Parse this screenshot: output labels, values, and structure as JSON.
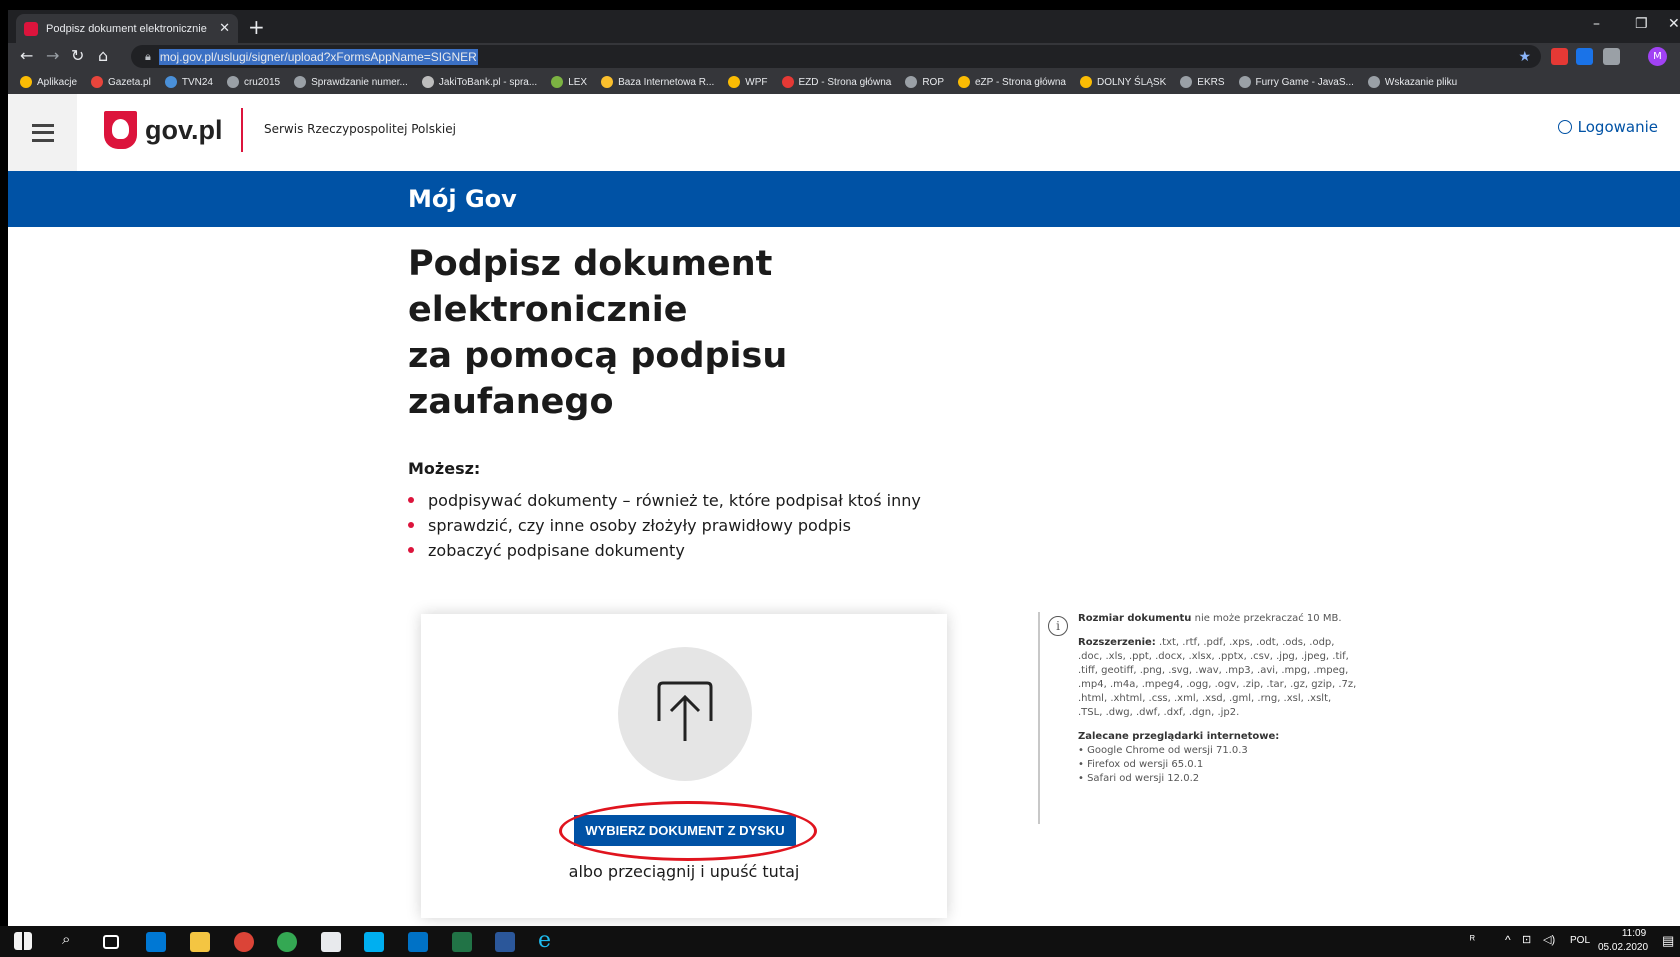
{
  "browser": {
    "tab_title": "Podpisz dokument elektronicznie",
    "tab_close": "✕",
    "new_tab": "+",
    "url": "moj.gov.pl/uslugi/signer/upload?xFormsAppName=SIGNER",
    "profile_initial": "M",
    "window_controls": [
      "–",
      "❐",
      "✕"
    ],
    "bookmarks": [
      {
        "label": "Aplikacje",
        "icon": "apps-grid-icon",
        "color": "#fbbc04"
      },
      {
        "label": "Gazeta.pl",
        "icon": "gazeta-icon",
        "color": "#e8453c"
      },
      {
        "label": "TVN24",
        "icon": "tvn24-icon",
        "color": "#4a90d9"
      },
      {
        "label": "cru2015",
        "icon": "globe-icon",
        "color": "#9aa0a6"
      },
      {
        "label": "Sprawdzanie numer...",
        "icon": "globe-icon",
        "color": "#9aa0a6"
      },
      {
        "label": "JakiToBank.pl - spra...",
        "icon": "jakitobank-icon",
        "color": "#bdbdbd"
      },
      {
        "label": "LEX",
        "icon": "lex-icon",
        "color": "#7cb342"
      },
      {
        "label": "Baza Internetowa R...",
        "icon": "baza-icon",
        "color": "#fbc02d"
      },
      {
        "label": "WPF",
        "icon": "emblem-icon",
        "color": "#fbbc04"
      },
      {
        "label": "EZD - Strona główna",
        "icon": "ezd-icon",
        "color": "#e53935"
      },
      {
        "label": "ROP",
        "icon": "globe-icon",
        "color": "#9aa0a6"
      },
      {
        "label": "eZP - Strona główna",
        "icon": "emblem-icon",
        "color": "#fbbc04"
      },
      {
        "label": "DOLNY ŚLĄSK",
        "icon": "emblem-icon",
        "color": "#fbbc04"
      },
      {
        "label": "EKRS",
        "icon": "eagle-icon",
        "color": "#9aa0a6"
      },
      {
        "label": "Furry Game - JavaS...",
        "icon": "globe-icon",
        "color": "#9aa0a6"
      },
      {
        "label": "Wskazanie pliku",
        "icon": "globe-icon",
        "color": "#9aa0a6"
      }
    ],
    "bookmarks_overflow": "»"
  },
  "header": {
    "logo_text": "gov.pl",
    "subtitle": "Serwis Rzeczypospolitej Polskiej",
    "login": "Logowanie"
  },
  "band": {
    "title": "Mój Gov"
  },
  "main": {
    "title_lines": [
      "Podpisz dokument",
      "elektronicznie",
      "za pomocą podpisu",
      "zaufanego"
    ],
    "can_label": "Możesz:",
    "features": [
      "podpisywać dokumenty – również te, które podpisał ktoś inny",
      "sprawdzić, czy inne osoby złożyły prawidłowy podpis",
      "zobaczyć podpisane dokumenty"
    ]
  },
  "upload": {
    "button_label": "WYBIERZ DOKUMENT Z DYSKU",
    "drop_text": "albo przeciągnij i upuść tutaj"
  },
  "info": {
    "size_label": "Rozmiar dokumentu",
    "size_text": " nie może przekraczać 10 MB.",
    "ext_label": "Rozszerzenie:",
    "ext_text": " .txt, .rtf, .pdf, .xps, .odt, .ods, .odp, .doc, .xls, .ppt, .docx, .xlsx, .pptx, .csv, .jpg, .jpeg, .tif, .tiff, geotiff, .png, .svg, .wav, .mp3, .avi, .mpg, .mpeg, .mp4, .m4a, .mpeg4, .ogg, .ogv, .zip, .tar, .gz, gzip, .7z, .html, .xhtml, .css, .xml, .xsd, .gml, .rng, .xsl, .xslt, .TSL, .dwg, .dwf, .dxf, .dgn, .jp2.",
    "browsers_label": "Zalecane przeglądarki internetowe:",
    "browsers": [
      "• Google Chrome od wersji 71.0.3",
      "• Firefox od wersji 65.0.1",
      "• Safari od wersji 12.0.2"
    ]
  },
  "taskbar": {
    "time": "11:09",
    "date": "05.02.2020",
    "language": "POL"
  },
  "colors": {
    "gov_blue": "#0052a5",
    "gov_red": "#dc143c",
    "highlight_oval": "#e0141e"
  }
}
